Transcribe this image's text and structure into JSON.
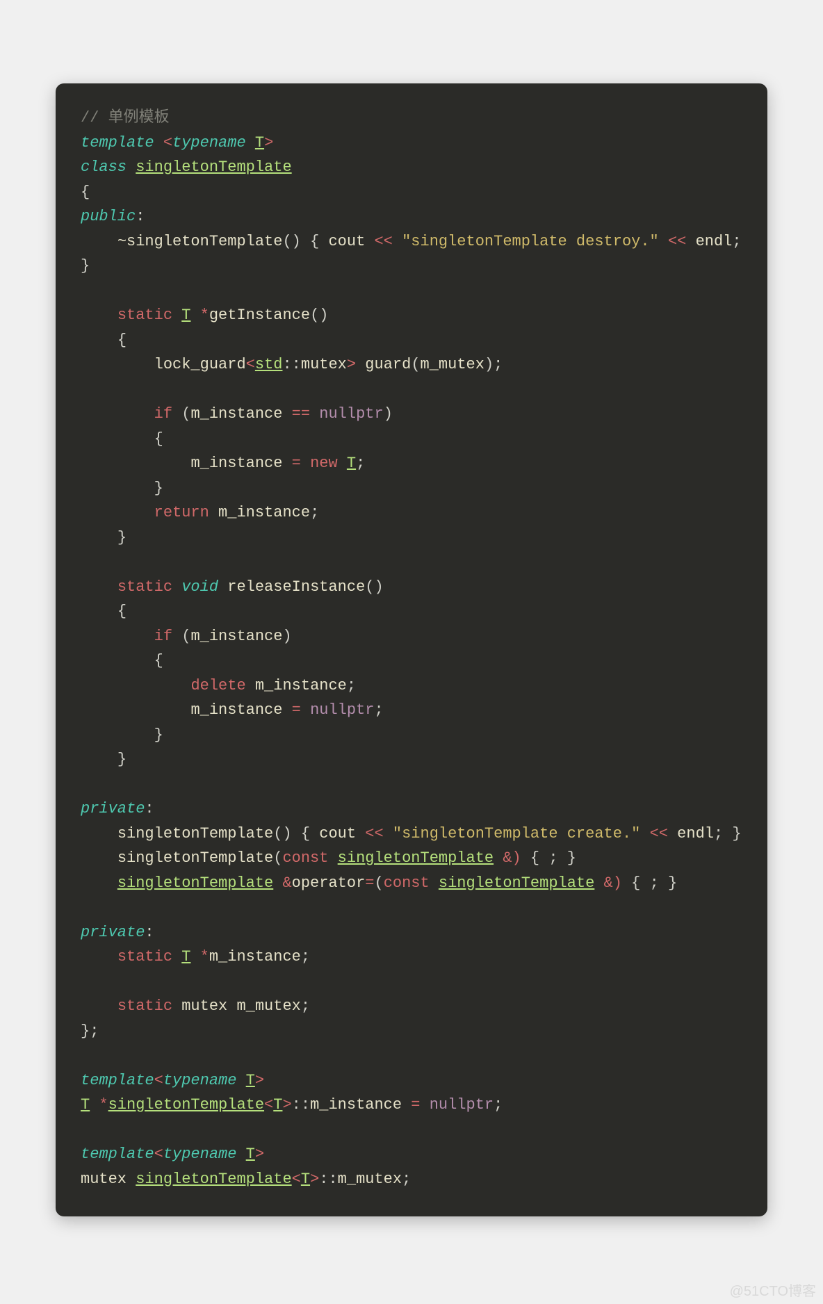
{
  "code": {
    "t": [
      "// 单例模板",
      "template",
      "class",
      "public",
      "private",
      "typename",
      "void",
      "static",
      "const",
      "new",
      "delete",
      "if",
      "return",
      "T",
      "singletonTemplate",
      "std",
      "~singletonTemplate",
      "getInstance",
      "releaseInstance",
      "lock_guard",
      "guard",
      "operator",
      "singletonTemplate",
      "cout",
      "endl",
      "mutex",
      "m_instance",
      "m_mutex",
      "nullptr",
      "\"singletonTemplate destroy.\"",
      "\"singletonTemplate create.\"",
      "<<",
      "<",
      ">",
      "{",
      "}",
      "(",
      ")",
      ";",
      "*",
      "&",
      "=",
      "==",
      "::",
      ",",
      ":",
      "&)",
      "()"
    ]
  },
  "watermark": "@51CTO博客"
}
